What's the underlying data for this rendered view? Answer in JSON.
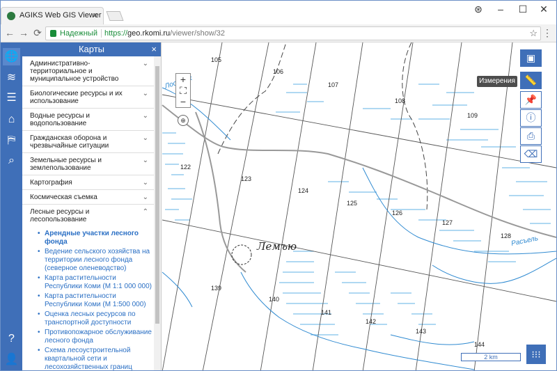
{
  "browser": {
    "tab_title": "AGIKS Web GIS Viewer",
    "tab_close": "×",
    "secure_label": "Надежный",
    "url_scheme": "https://",
    "url_host": "geo.rkomi.ru",
    "url_path": "/viewer/show/32",
    "controls": {
      "minimize": "–",
      "maximize": "☐",
      "close": "✕",
      "profile": "⊛",
      "back": "←",
      "forward": "→",
      "reload": "⟳",
      "star": "☆",
      "menu": "⋮"
    }
  },
  "panel": {
    "title": "Карты",
    "close": "×",
    "categories": [
      {
        "label": "Административно-территориальное и муниципальное устройство"
      },
      {
        "label": "Биологические ресурсы и их использование"
      },
      {
        "label": "Водные ресурсы и водопользование"
      },
      {
        "label": "Гражданская оборона и чрезвычайные ситуации"
      },
      {
        "label": "Земельные ресурсы и землепользование"
      },
      {
        "label": "Картография"
      },
      {
        "label": "Космическая съемка"
      },
      {
        "label": "Лесные ресурсы и лесопользование"
      }
    ],
    "forest_layers": [
      "Арендные участки лесного фонда",
      "Ведение сельского хозяйства на территории лесного фонда (северное оленеводство)",
      "Карта растительности Республики Коми (М 1:1 000 000)",
      "Карта растительности Республики Коми (М 1:500 000)",
      "Оценка лесных ресурсов по транспортной доступности",
      "Противопожарное обслуживание лесного фонда",
      "Схема лесоустроительной квартальной сети и лесохозяйственных границ"
    ]
  },
  "map": {
    "place_label": "Лемъю",
    "river_labels": [
      "Лоселдж",
      "Расъель"
    ],
    "quarter_numbers": [
      "105",
      "106",
      "107",
      "108",
      "109",
      "122",
      "123",
      "124",
      "125",
      "126",
      "127",
      "128",
      "139",
      "140",
      "141",
      "142",
      "143",
      "144"
    ],
    "scale_label": "2 km",
    "tooltip": "Измерения",
    "zoom_in": "+",
    "zoom_out": "−",
    "fullscreen": "⛶",
    "locate": "⊕"
  },
  "left_tools": {
    "globe": "🌐",
    "layers": "≋",
    "list": "☰",
    "tag": "⌂",
    "route": "⛿",
    "search": "⌕",
    "help": "?",
    "user": "👤"
  },
  "right_tools": {
    "toolbox": "▣",
    "measure": "📏",
    "pin": "📌",
    "info": "ⓘ",
    "print": "⎙",
    "eraser": "⌫"
  },
  "grid_button": "⁝⁝⁝"
}
